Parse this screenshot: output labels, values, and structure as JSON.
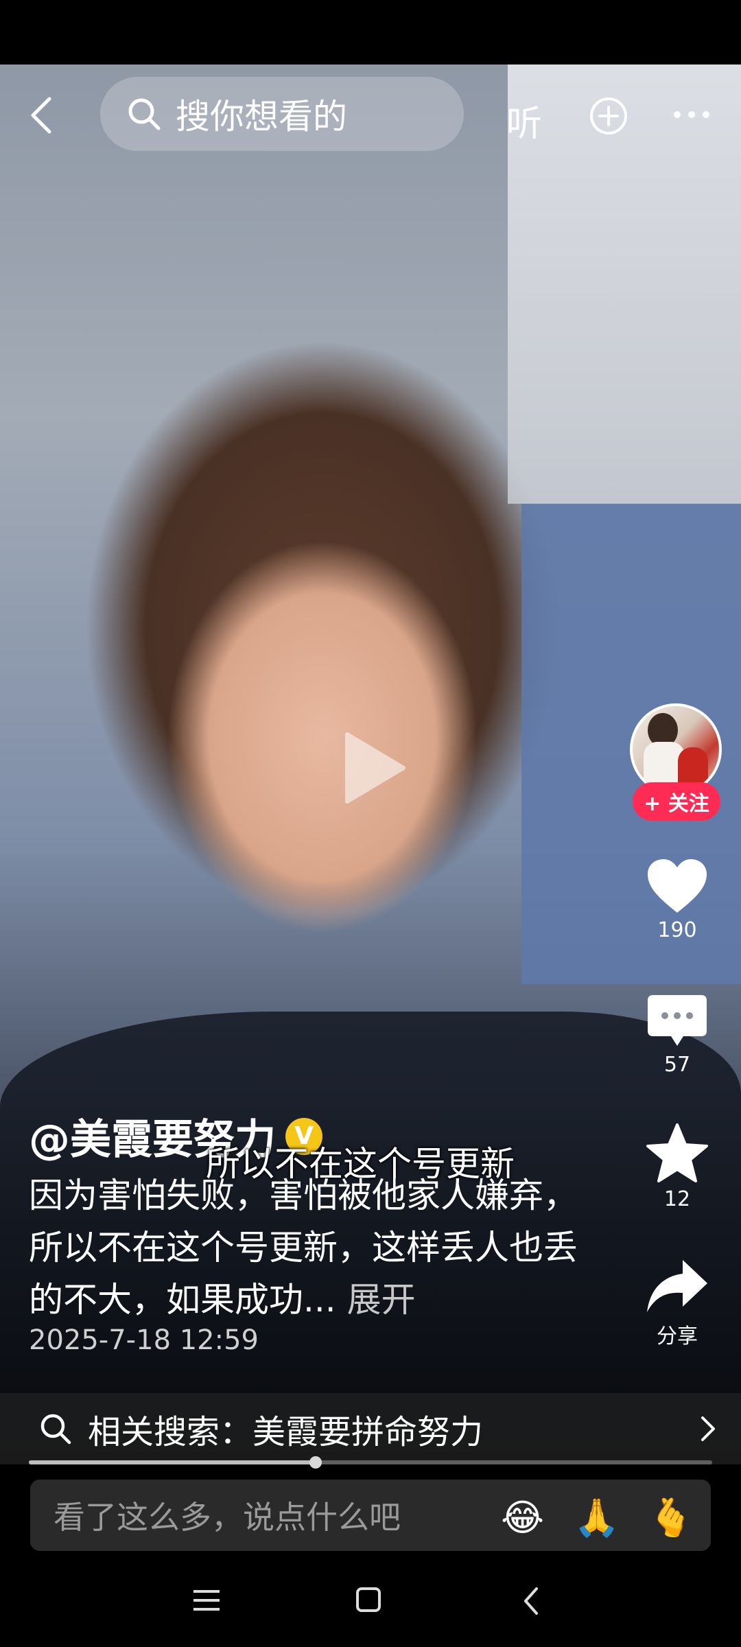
{
  "top_bar": {
    "search_placeholder": "搜你想看的",
    "listen_label": "听"
  },
  "overlay_subtitle": "所以不在这个号更新",
  "right_rail": {
    "follow_label": "+ 关注",
    "likes": "190",
    "comments": "57",
    "favorites": "12",
    "share_label": "分享"
  },
  "post": {
    "author": "@美霞要努力",
    "verified_badge": "V",
    "description": "因为害怕失败，害怕被他家人嫌弃，所以不在这个号更新，这样丢人也丢的不大，如果成功...",
    "expand_label": "展开",
    "timestamp": "2025-7-18 12:59"
  },
  "related_search": {
    "label": "相关搜索：美霞要拼命努力"
  },
  "playback": {
    "progress_fraction": 0.42
  },
  "comment_box": {
    "placeholder": "看了这么多，说点什么吧",
    "emojis": [
      "😂",
      "🙏",
      "🫰"
    ]
  },
  "colors": {
    "accent": "#fe2c55",
    "badge": "#f5c518"
  }
}
